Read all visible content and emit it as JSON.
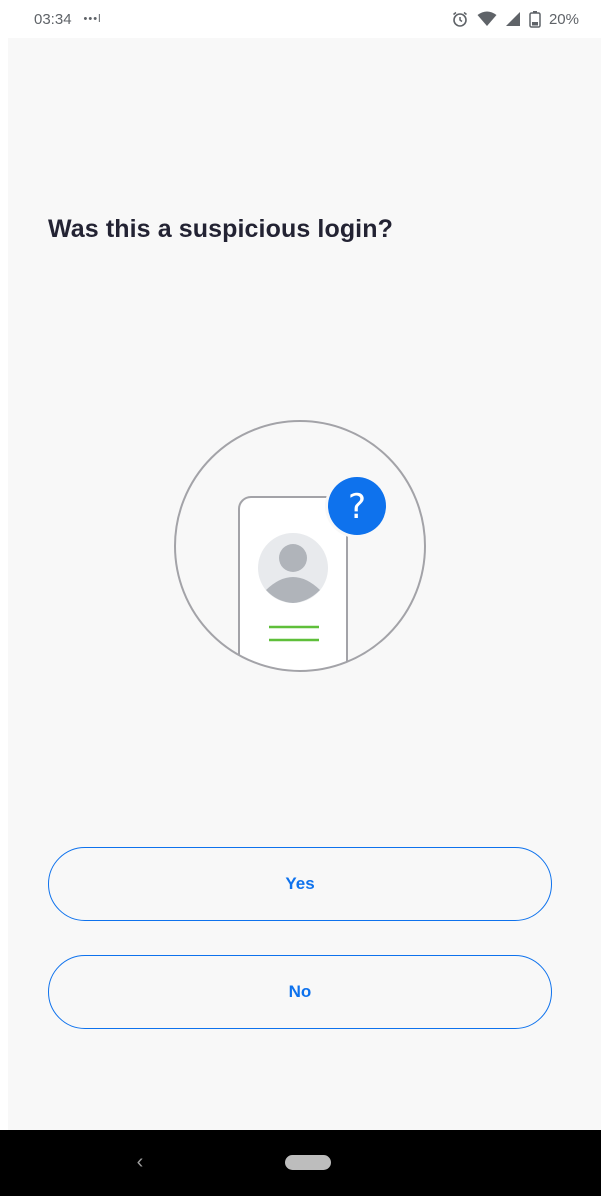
{
  "status_bar": {
    "time": "03:34",
    "notification_dots": "•••l",
    "battery_percent": "20%",
    "icons": [
      "alarm-icon",
      "wifi-icon",
      "cell-signal-icon",
      "battery-icon"
    ]
  },
  "page": {
    "title": "Was this a suspicious login?"
  },
  "illustration": {
    "icons": [
      "phone-profile-illustration",
      "question-mark-badge-icon"
    ],
    "badge_symbol": "?",
    "colors": {
      "circle_outline": "#a3a3a8",
      "badge": "#0e72ed",
      "avatar_bg": "#e8eaed",
      "avatar_fg": "#b0b4ba",
      "accent_lines": "#5fbf3a"
    }
  },
  "actions": {
    "yes_label": "Yes",
    "no_label": "No"
  },
  "nav_bar": {
    "back_symbol": "‹",
    "icons": [
      "back-icon",
      "home-pill-icon"
    ]
  },
  "colors": {
    "accent": "#0e72ed",
    "title_text": "#232333",
    "background": "#f8f8f8"
  }
}
